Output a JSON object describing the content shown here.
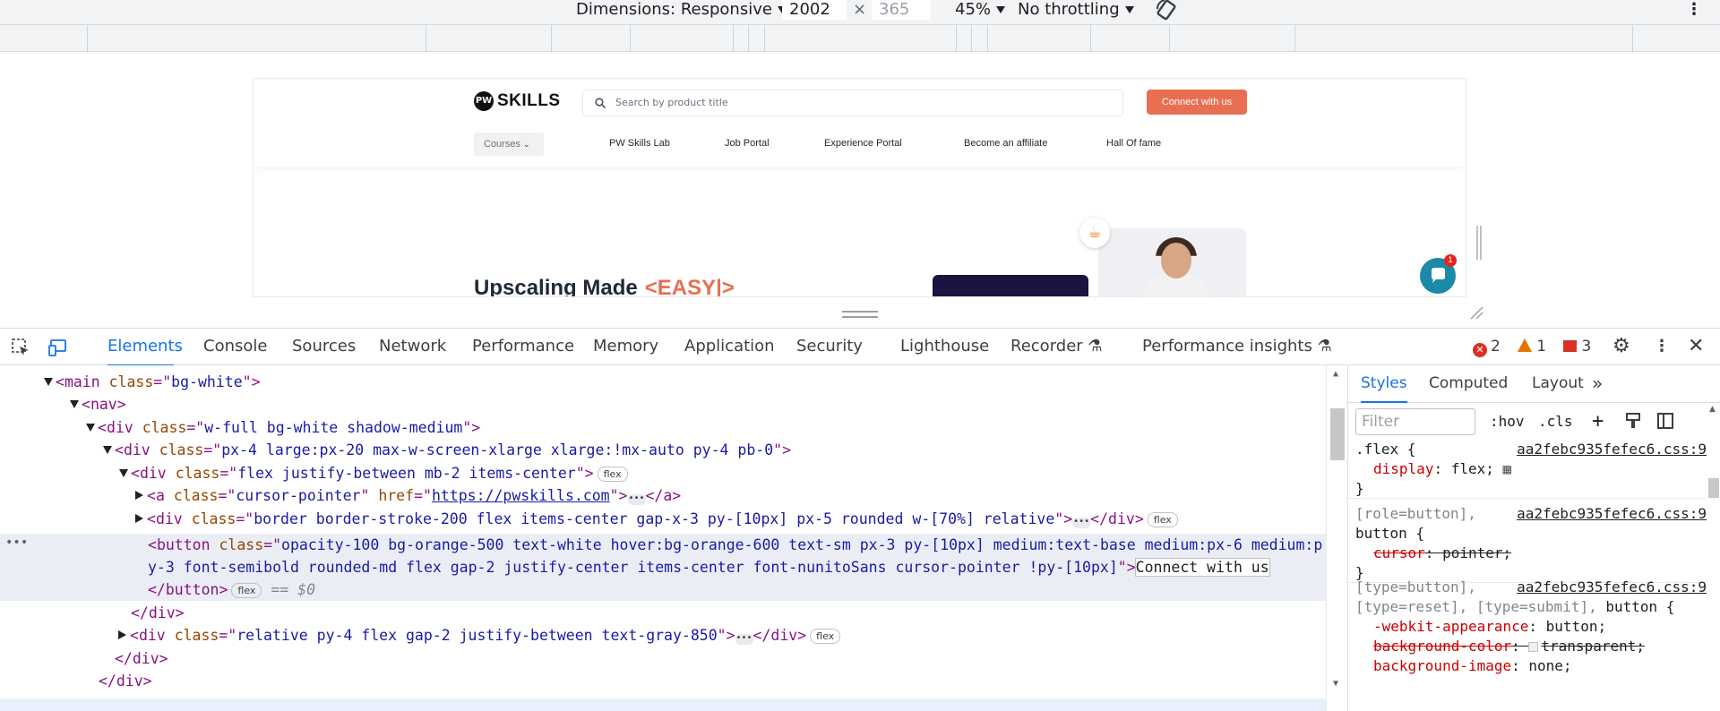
{
  "device_toolbar": {
    "dimensions_label": "Dimensions: Responsive",
    "width_value": "2002",
    "times": "×",
    "height_placeholder": "365",
    "zoom": "45%",
    "throttling": "No throttling",
    "rotate_icon": "rotate-icon",
    "more_icon": "more-vert-icon"
  },
  "site": {
    "logo_text": "SKILLS",
    "logo_mark": "PW",
    "search_placeholder": "Search by product title",
    "cta_label": "Connect with us",
    "nav": {
      "courses": "Courses",
      "items": [
        "PW Skills Lab",
        "Job Portal",
        "Experience Portal",
        "Become an affiliate",
        "Hall Of fame"
      ]
    },
    "hero_title": "Upscaling Made",
    "hero_accent": "<EASY|>",
    "chat_badge": "1",
    "accent_color": "#e86f52"
  },
  "devtools": {
    "tabs": [
      "Elements",
      "Console",
      "Sources",
      "Network",
      "Performance",
      "Memory",
      "Application",
      "Security",
      "Lighthouse",
      "Recorder",
      "Performance insights"
    ],
    "active_tab": "Elements",
    "counts": {
      "errors": "2",
      "warnings": "1",
      "issues": "3"
    },
    "elements": {
      "tree": {
        "main": {
          "tag": "main",
          "attr": "class",
          "value": "bg-white"
        },
        "nav": {
          "tag": "nav"
        },
        "div1": {
          "tag": "div",
          "attr": "class",
          "value": "w-full bg-white shadow-medium"
        },
        "div2": {
          "tag": "div",
          "attr": "class",
          "value": "px-4 large:px-20 max-w-screen-xlarge xlarge:!mx-auto py-4 pb-0"
        },
        "div3": {
          "tag": "div",
          "attr": "class",
          "value": "flex justify-between mb-2 items-center",
          "badge": "flex"
        },
        "a": {
          "tag": "a",
          "attr": "class",
          "value": "cursor-pointer",
          "attr2": "href",
          "href": "https://pwskills.com"
        },
        "div4": {
          "tag": "div",
          "attr": "class",
          "value": "border border-stroke-200 flex items-center gap-x-3 py-[10px] px-5 rounded w-[70%] relative",
          "badge": "flex"
        },
        "button": {
          "tag": "button",
          "attr": "class",
          "value_line1": "opacity-100 bg-orange-500 text-white hover:bg-orange-600 text-sm px-3 py-[10px] medium:text-base medium:px-6 medium:p",
          "value_line2": "y-3 font-semibold rounded-md flex gap-2 justify-center items-center font-nunitoSans cursor-pointer !py-[10px]",
          "text": "Connect with us",
          "badge": "flex",
          "eq": "== $0"
        },
        "close_div": "</div>",
        "div5": {
          "tag": "div",
          "attr": "class",
          "value": "relative py-4 flex gap-2 justify-between text-gray-850",
          "badge": "flex"
        },
        "close_div2": "</div>",
        "close_div3": "</div>"
      }
    },
    "styles": {
      "tabs": [
        "Styles",
        "Computed",
        "Layout"
      ],
      "more_tabs_icon": "chevron-double-right-icon",
      "filter_placeholder": "Filter",
      "hov": ":hov",
      "cls": ".cls",
      "rules": [
        {
          "selector": ".flex {",
          "source": "aa2febc935fefec6.css:9",
          "props": [
            {
              "name": "display",
              "value": "flex;"
            }
          ],
          "close": "}"
        },
        {
          "selector": "[role=button],",
          "selector2": "button {",
          "source": "aa2febc935fefec6.css:9",
          "props": [
            {
              "name": "cursor",
              "value": "pointer;",
              "struck": true
            }
          ],
          "close": "}"
        },
        {
          "selector": "[type=button],",
          "selector2": "[type=reset], [type=submit], button {",
          "source": "aa2febc935fefec6.css:9",
          "props": [
            {
              "name": "-webkit-appearance",
              "value": "button;"
            },
            {
              "name": "background-color",
              "value": "transparent;",
              "struck": true
            },
            {
              "name": "background-image",
              "value": "none;"
            }
          ]
        }
      ]
    }
  }
}
